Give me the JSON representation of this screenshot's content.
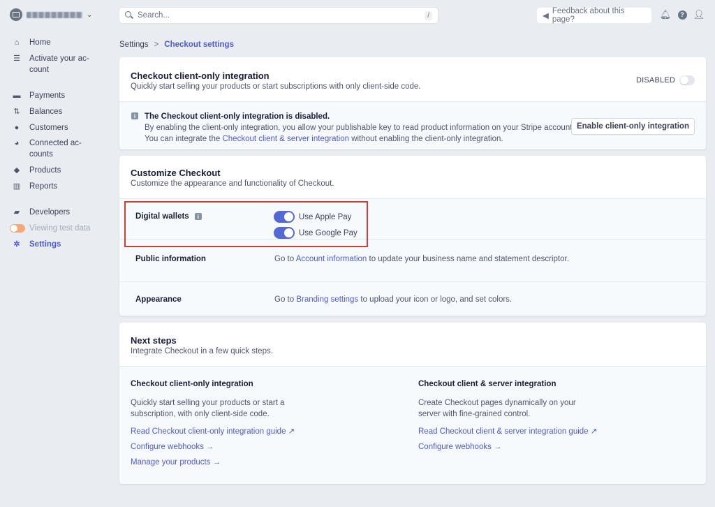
{
  "account": {
    "name": "Account name"
  },
  "nav": {
    "items": [
      {
        "label": "Home",
        "icon": "home-icon"
      },
      {
        "label": "Activate your ac-\ncount",
        "icon": "activate-icon"
      },
      {
        "label": "Payments",
        "icon": "payments-icon"
      },
      {
        "label": "Balances",
        "icon": "balances-icon"
      },
      {
        "label": "Customers",
        "icon": "customers-icon"
      },
      {
        "label": "Connected ac-\ncounts",
        "icon": "connected-icon"
      },
      {
        "label": "Products",
        "icon": "products-icon"
      },
      {
        "label": "Reports",
        "icon": "reports-icon"
      },
      {
        "label": "Developers",
        "icon": "developers-icon"
      },
      {
        "label": "Viewing test data",
        "icon": "toggle-icon"
      },
      {
        "label": "Settings",
        "icon": "gear-icon"
      }
    ]
  },
  "search": {
    "placeholder": "Search...",
    "shortcut": "/"
  },
  "feedback": {
    "label": "Feedback about this page?"
  },
  "breadcrumb": {
    "parent": "Settings",
    "separator": ">",
    "current": "Checkout settings"
  },
  "client_only": {
    "title": "Checkout client-only integration",
    "subtitle": "Quickly start selling your products or start subscriptions with only client-side code.",
    "status": "DISABLED",
    "notice_title": "The Checkout client-only integration is disabled.",
    "notice_line1": "By enabling the client-only integration, you allow your publishable key to read product information on your Stripe account.",
    "notice_line2_pre": "You can integrate the ",
    "notice_line2_link": "Checkout client & server integration",
    "notice_line2_post": " without enabling the client-only integration.",
    "enable_button": "Enable client-only integration"
  },
  "customize": {
    "title": "Customize Checkout",
    "subtitle": "Customize the appearance and functionality of Checkout.",
    "wallets_label": "Digital wallets",
    "apple_pay": "Use Apple Pay",
    "google_pay": "Use Google Pay",
    "apple_pay_on": true,
    "google_pay_on": true,
    "public_label": "Public information",
    "public_pre": "Go to ",
    "public_link": "Account information",
    "public_post": " to update your business name and statement descriptor.",
    "appearance_label": "Appearance",
    "appearance_pre": "Go to ",
    "appearance_link": "Branding settings",
    "appearance_post": " to upload your icon or logo, and set colors."
  },
  "next_steps": {
    "title": "Next steps",
    "subtitle": "Integrate Checkout in a few quick steps.",
    "col_a": {
      "title": "Checkout client-only integration",
      "desc": "Quickly start selling your products or start a subscription, with only client-side code.",
      "links": [
        "Read Checkout client-only integration guide ↗",
        "Configure webhooks →",
        "Manage your products →"
      ]
    },
    "col_b": {
      "title": "Checkout client & server integration",
      "desc": "Create Checkout pages dynamically on your server with fine-grained control.",
      "links": [
        "Read Checkout client & server integration guide ↗",
        "Configure webhooks →"
      ]
    }
  },
  "colors": {
    "accent": "#4f5bd5",
    "toggle_on": "#5469d4",
    "highlight": "#d33c3c",
    "background": "#e9ecf1"
  }
}
